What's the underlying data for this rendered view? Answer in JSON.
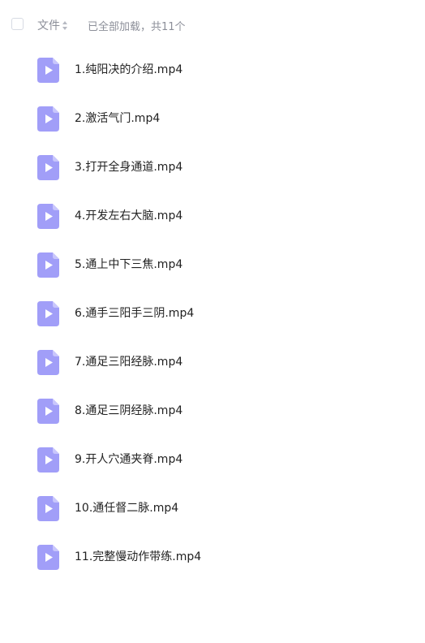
{
  "header": {
    "column_label": "文件",
    "status": "已全部加载，共11个"
  },
  "icon": {
    "name": "video-file-icon",
    "color": "#a19ef8",
    "fold_color": "#c8c6fc"
  },
  "files": [
    {
      "name": "1.纯阳决的介绍.mp4"
    },
    {
      "name": "2.激活气门.mp4"
    },
    {
      "name": "3.打开全身通道.mp4"
    },
    {
      "name": "4.开发左右大脑.mp4"
    },
    {
      "name": "5.通上中下三焦.mp4"
    },
    {
      "name": "6.通手三阳手三阴.mp4"
    },
    {
      "name": "7.通足三阳经脉.mp4"
    },
    {
      "name": "8.通足三阴经脉.mp4"
    },
    {
      "name": "9.开人穴通夹脊.mp4"
    },
    {
      "name": "10.通任督二脉.mp4"
    },
    {
      "name": "11.完整慢动作带练.mp4"
    }
  ]
}
